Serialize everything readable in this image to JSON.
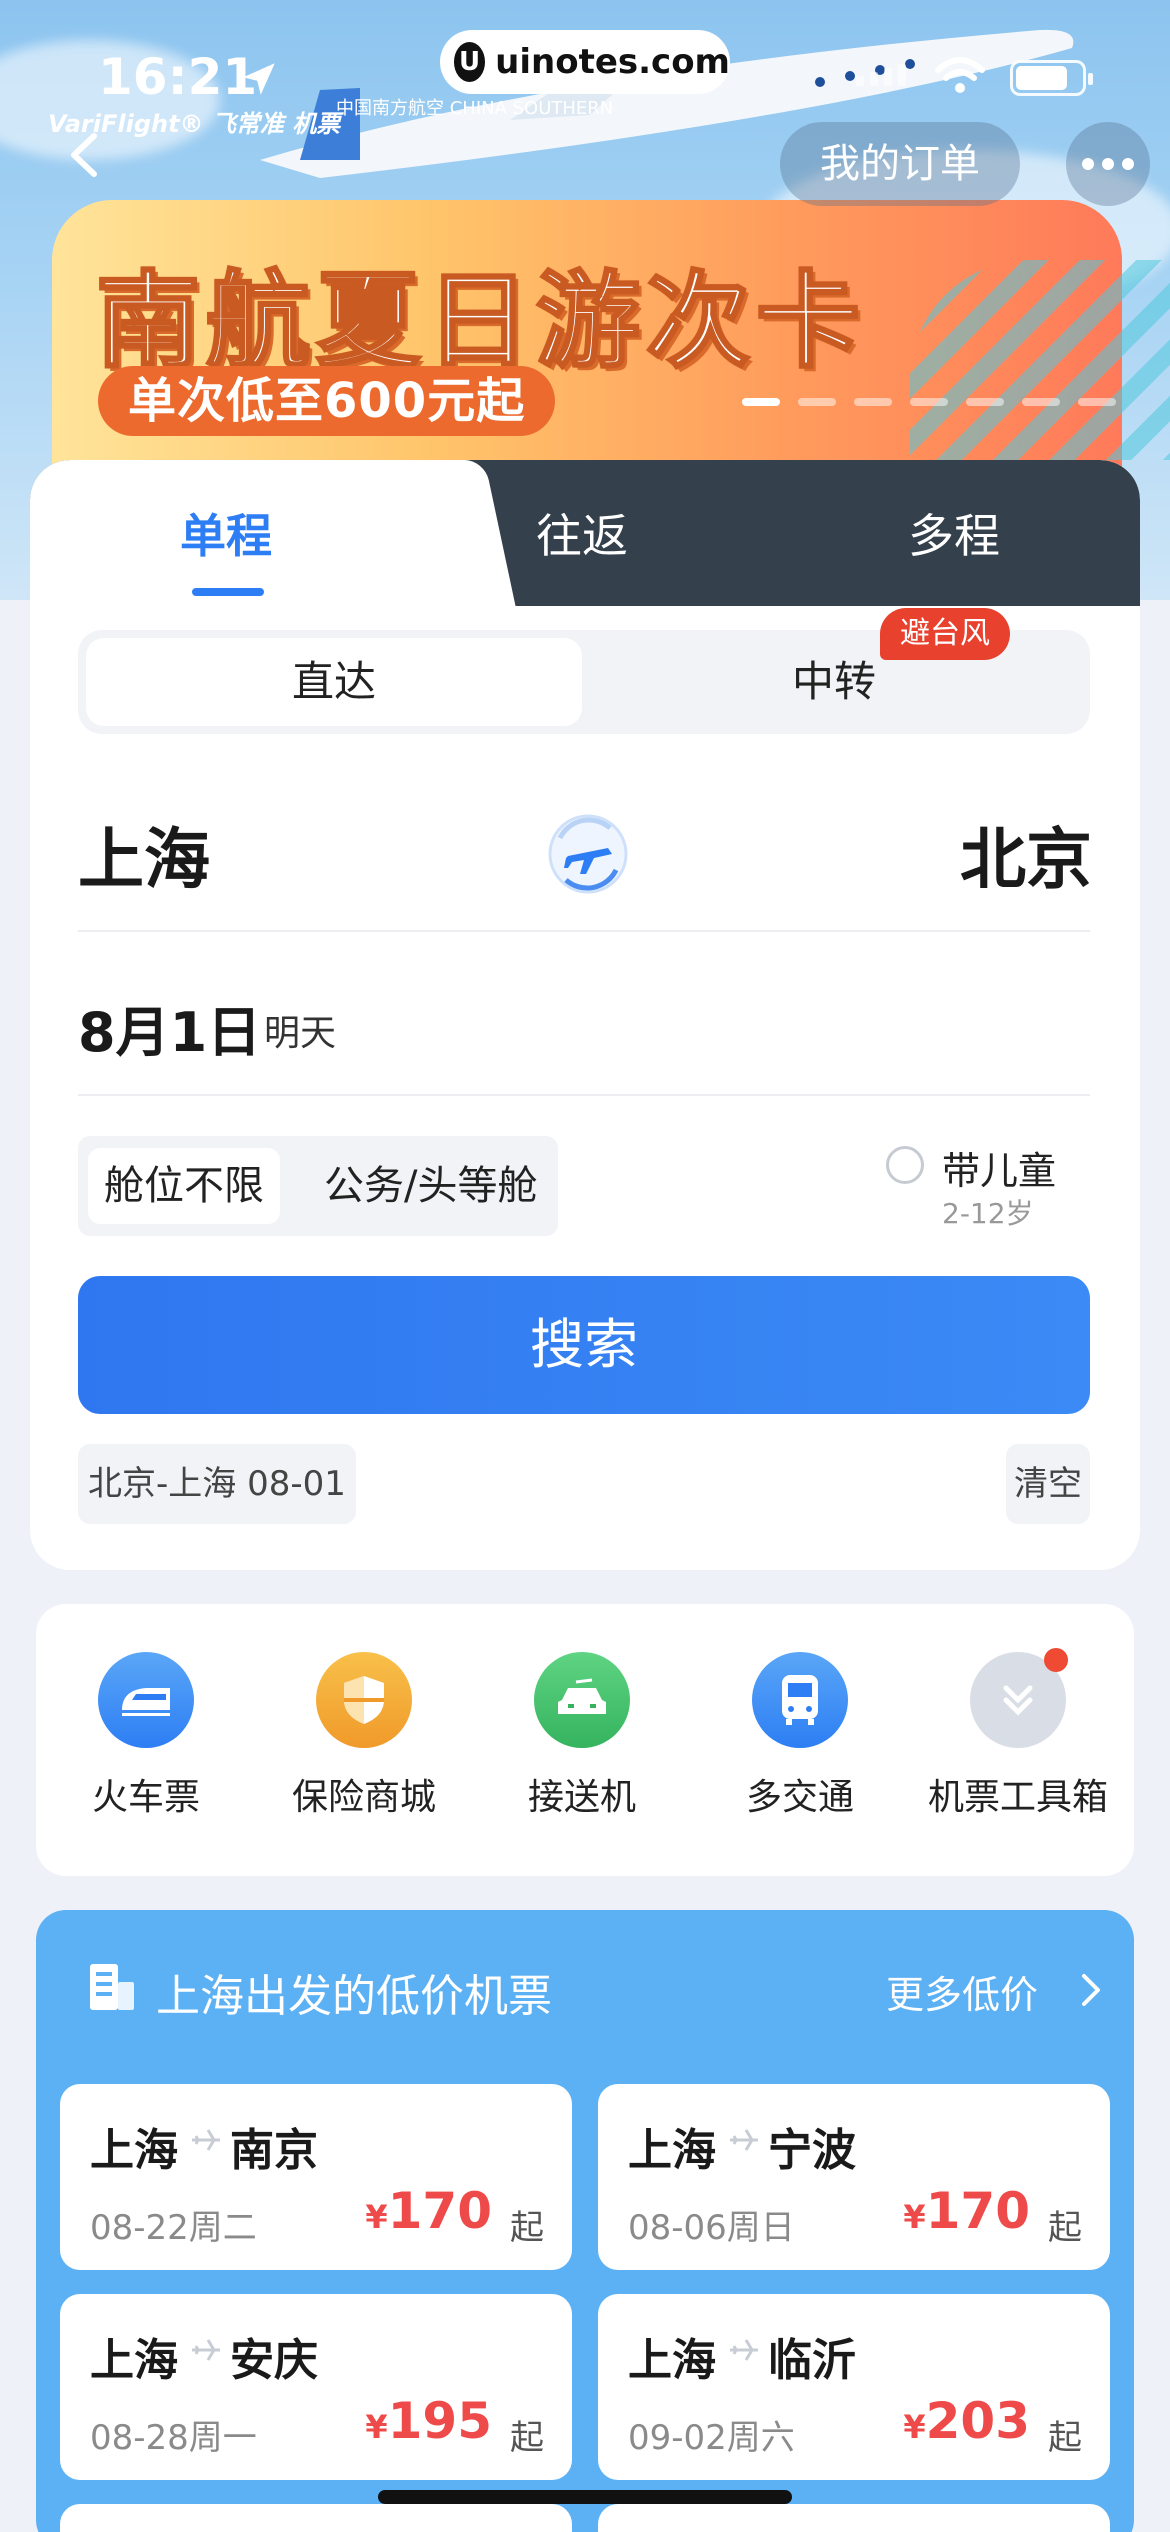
{
  "status_bar": {
    "time": "16:21",
    "variflight_label": "VariFlight® 飞常准 机票",
    "airline_logo_text": "中国南方航空 CHINA SOUTHERN",
    "icons": [
      "location-arrow-icon",
      "signal-icon",
      "wifi-icon",
      "battery-icon"
    ]
  },
  "watermark": {
    "logo": "U",
    "text": "uinotes.com"
  },
  "header": {
    "back_icon": "chevron-left-icon",
    "my_orders_label": "我的订单",
    "more_icon": "more-dots-icon"
  },
  "banner": {
    "title": "南航夏日游次卡",
    "pill": "单次低至600元起",
    "carousel_count": 7,
    "carousel_active": 1
  },
  "trip_tabs": [
    {
      "label": "单程",
      "active": true
    },
    {
      "label": "往返",
      "active": false
    },
    {
      "label": "多程",
      "active": false
    }
  ],
  "route_type": {
    "options": [
      {
        "label": "直达",
        "selected": true
      },
      {
        "label": "中转",
        "selected": false
      }
    ],
    "badge": "避台风"
  },
  "route": {
    "from": "上海",
    "to": "北京",
    "swap_icon": "swap-plane-icon"
  },
  "date": {
    "value": "8月1日",
    "relative": "明天"
  },
  "cabin": {
    "options": [
      {
        "label": "舱位不限",
        "selected": true
      },
      {
        "label": "公务/头等舱",
        "selected": false
      }
    ]
  },
  "child": {
    "label": "带儿童",
    "age": "2-12岁",
    "checked": false
  },
  "search_button": "搜索",
  "history": {
    "item": "北京-上海 08-01",
    "clear_label": "清空"
  },
  "services": [
    {
      "label": "火车票",
      "icon": "train-icon",
      "color": "#3a8ef2"
    },
    {
      "label": "保险商城",
      "icon": "shield-icon",
      "color": "#f2a534"
    },
    {
      "label": "接送机",
      "icon": "car-icon",
      "color": "#43c26a"
    },
    {
      "label": "多交通",
      "icon": "bus-icon",
      "color": "#3a8ef2"
    },
    {
      "label": "机票工具箱",
      "icon": "toolbox-chevron-icon",
      "color": "#d9dde6"
    }
  ],
  "low_price": {
    "title": "上海出发的低价机票",
    "more_label": "更多低价",
    "routes": [
      {
        "from": "上海",
        "to": "南京",
        "date": "08-22周二",
        "currency": "¥",
        "price": "170",
        "suffix": "起"
      },
      {
        "from": "上海",
        "to": "宁波",
        "date": "08-06周日",
        "currency": "¥",
        "price": "170",
        "suffix": "起"
      },
      {
        "from": "上海",
        "to": "安庆",
        "date": "08-28周一",
        "currency": "¥",
        "price": "195",
        "suffix": "起"
      },
      {
        "from": "上海",
        "to": "临沂",
        "date": "09-02周六",
        "currency": "¥",
        "price": "203",
        "suffix": "起"
      }
    ]
  },
  "colors": {
    "accent": "#2d7ef4",
    "tab_dark": "#34414d",
    "price_red": "#ef4a4a",
    "badge_red": "#e8412e",
    "section_blue": "#5cb0f4"
  }
}
